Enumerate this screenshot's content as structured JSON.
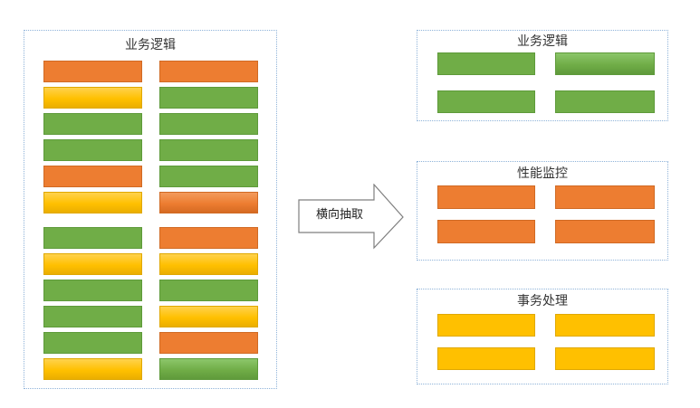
{
  "colors": {
    "green": "#70ad47",
    "orange": "#ed7d31",
    "yellow": "#ffc000",
    "border": "#8fb3d9"
  },
  "left_panel": {
    "title": "业务逻辑",
    "col_a": [
      "orange",
      "yellow",
      "green",
      "green",
      "orange",
      "yellow",
      "green",
      "yellow",
      "green",
      "green",
      "green",
      "yellow"
    ],
    "col_b": [
      "orange",
      "green",
      "green",
      "green",
      "green",
      "orange",
      "orange",
      "yellow",
      "green",
      "yellow",
      "orange",
      "green"
    ]
  },
  "arrow": {
    "label": "横向抽取"
  },
  "right_panels": [
    {
      "title": "业务逻辑",
      "color": "green"
    },
    {
      "title": "性能监控",
      "color": "orange"
    },
    {
      "title": "事务处理",
      "color": "yellow"
    }
  ]
}
